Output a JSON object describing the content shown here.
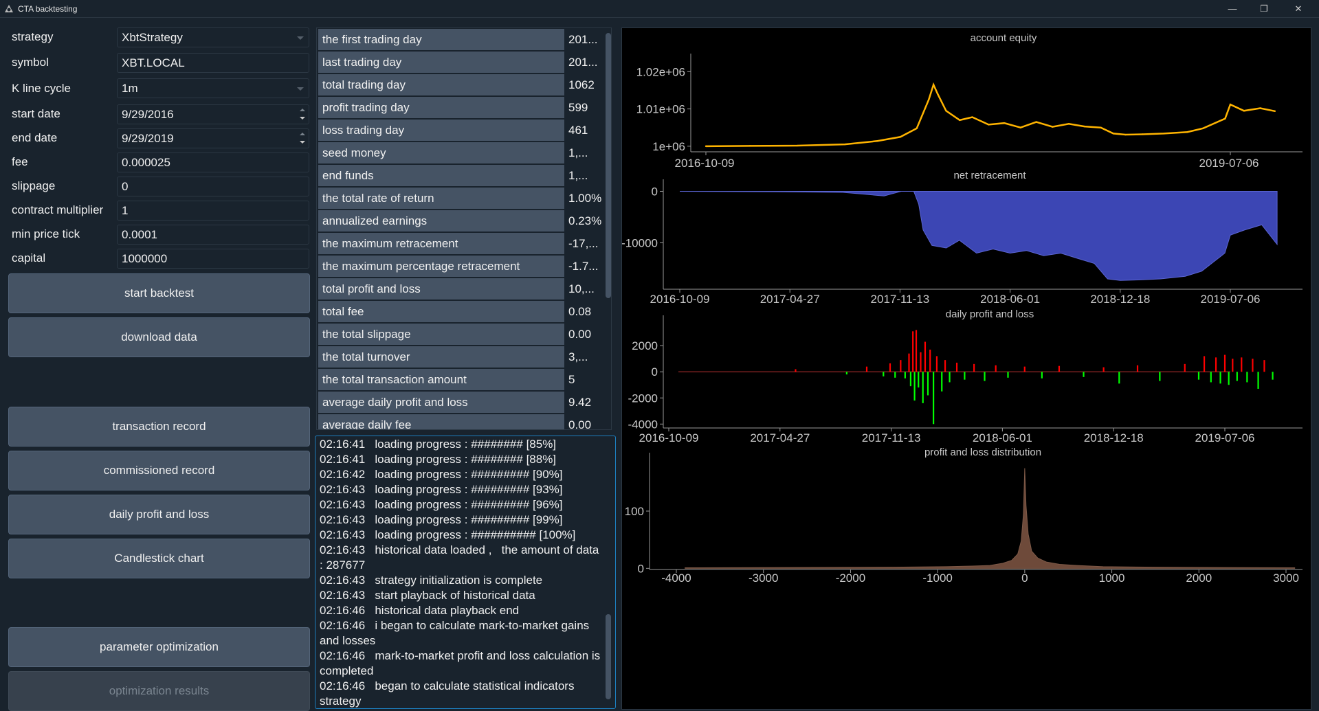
{
  "window": {
    "title": "CTA backtesting",
    "controls": [
      "—",
      "❐",
      "✕"
    ]
  },
  "form": {
    "strategy": {
      "label": "strategy",
      "value": "XbtStrategy"
    },
    "symbol": {
      "label": "symbol",
      "value": "XBT.LOCAL"
    },
    "kline": {
      "label": "K line cycle",
      "value": "1m"
    },
    "start_date": {
      "label": "start date",
      "value": "9/29/2016"
    },
    "end_date": {
      "label": "end date",
      "value": "9/29/2019"
    },
    "fee": {
      "label": "fee",
      "value": "0.000025"
    },
    "slippage": {
      "label": "slippage",
      "value": "0"
    },
    "contract_multiplier": {
      "label": "contract multiplier",
      "value": "1"
    },
    "min_price_tick": {
      "label": "min price tick",
      "value": "0.0001"
    },
    "capital": {
      "label": "capital",
      "value": "1000000"
    }
  },
  "buttons": {
    "start_backtest": "start backtest",
    "download_data": "download data",
    "transaction_record": "transaction record",
    "commissioned_record": "commissioned record",
    "daily_pnl": "daily profit and loss",
    "candlestick": "Candlestick chart",
    "param_opt": "parameter optimization",
    "opt_results": "optimization results"
  },
  "stats": [
    {
      "name": "the first trading day",
      "value": "201..."
    },
    {
      "name": "last trading day",
      "value": "201..."
    },
    {
      "name": "total trading day",
      "value": "1062"
    },
    {
      "name": "profit trading day",
      "value": "599"
    },
    {
      "name": "loss trading day",
      "value": "461"
    },
    {
      "name": "seed money",
      "value": "1,..."
    },
    {
      "name": "end funds",
      "value": "1,..."
    },
    {
      "name": "the total rate of return",
      "value": "1.00%"
    },
    {
      "name": "annualized earnings",
      "value": "0.23%"
    },
    {
      "name": "the maximum retracement",
      "value": "-17,..."
    },
    {
      "name": "the maximum percentage retracement",
      "value": "-1.7..."
    },
    {
      "name": "total profit and loss",
      "value": "10,..."
    },
    {
      "name": "total fee",
      "value": "0.08"
    },
    {
      "name": "the total slippage",
      "value": "0.00"
    },
    {
      "name": "the total turnover",
      "value": "3,..."
    },
    {
      "name": "the total transaction amount",
      "value": "5"
    },
    {
      "name": "average daily profit and loss",
      "value": "9.42"
    },
    {
      "name": "average daily fee",
      "value": "0.00"
    }
  ],
  "log": [
    "02:16:41   loading progress : ######## [85%]",
    "02:16:41   loading progress : ######## [88%]",
    "02:16:42   loading progress : ######### [90%]",
    "02:16:43   loading progress : ######### [93%]",
    "02:16:43   loading progress : ######### [96%]",
    "02:16:43   loading progress : ######### [99%]",
    "02:16:43   loading progress : ########## [100%]",
    "02:16:43   historical data loaded ,   the amount of data : 287677",
    "02:16:43   strategy initialization is complete",
    "02:16:43   start playback of historical data",
    "02:16:46   historical data playback end",
    "02:16:46   i began to calculate mark-to-market gains and losses",
    "02:16:46   mark-to-market profit and loss calculation is completed",
    "02:16:46   began to calculate statistical indicators",
    "strategy"
  ],
  "chart_data": [
    {
      "type": "line",
      "title": "account equity",
      "x_tick_labels": [
        "2016-10-09",
        "2019-07-06"
      ],
      "y_tick_labels": [
        "1e+06",
        "1.01e+06",
        "1.02e+06"
      ],
      "ylim": [
        998500,
        1023000
      ],
      "color": "#ffb400",
      "x": [
        "2016-10-09",
        "2017-01-01",
        "2017-04-01",
        "2017-07-01",
        "2017-09-01",
        "2017-10-15",
        "2017-11-15",
        "2017-12-08",
        "2017-12-17",
        "2017-12-25",
        "2018-01-10",
        "2018-02-05",
        "2018-03-01",
        "2018-04-01",
        "2018-05-01",
        "2018-06-01",
        "2018-07-01",
        "2018-08-01",
        "2018-09-01",
        "2018-10-01",
        "2018-11-01",
        "2018-11-25",
        "2018-12-18",
        "2019-01-20",
        "2019-03-01",
        "2019-04-15",
        "2019-05-15",
        "2019-06-26",
        "2019-07-06",
        "2019-08-01",
        "2019-09-01",
        "2019-09-29"
      ],
      "values": [
        1000000,
        1000100,
        1000150,
        1000500,
        1001400,
        1002500,
        1004800,
        1012500,
        1016500,
        1014000,
        1009500,
        1007000,
        1007800,
        1005800,
        1006200,
        1005000,
        1006500,
        1005200,
        1006000,
        1005300,
        1005000,
        1003400,
        1003100,
        1003200,
        1003400,
        1003800,
        1004800,
        1007400,
        1011200,
        1009500,
        1010200,
        1009400
      ]
    },
    {
      "type": "area",
      "title": "net retracement",
      "x_tick_labels": [
        "2016-10-09",
        "2017-04-27",
        "2017-11-13",
        "2018-06-01",
        "2018-12-18",
        "2019-07-06"
      ],
      "y_tick_labels": [
        "0",
        "-10000"
      ],
      "ylim": [
        -19000,
        1000
      ],
      "color": "#3c46b4",
      "x": [
        "2016-10-09",
        "2017-04-01",
        "2017-08-01",
        "2017-10-15",
        "2017-11-15",
        "2017-12-08",
        "2017-12-17",
        "2017-12-25",
        "2018-01-10",
        "2018-02-05",
        "2018-03-01",
        "2018-04-01",
        "2018-05-01",
        "2018-06-01",
        "2018-07-01",
        "2018-08-01",
        "2018-09-01",
        "2018-10-01",
        "2018-11-01",
        "2018-11-25",
        "2018-12-18",
        "2019-01-20",
        "2019-03-01",
        "2019-04-15",
        "2019-05-15",
        "2019-06-26",
        "2019-07-06",
        "2019-08-01",
        "2019-09-01",
        "2019-09-29"
      ],
      "values": [
        0,
        -80,
        -200,
        -900,
        0,
        0,
        -2500,
        -7500,
        -10500,
        -11000,
        -9500,
        -12000,
        -11200,
        -12000,
        -11500,
        -12500,
        -12000,
        -13000,
        -14000,
        -17000,
        -17300,
        -17200,
        -17000,
        -16500,
        -15500,
        -12000,
        -8500,
        -7500,
        -6500,
        -10300
      ]
    },
    {
      "type": "bar",
      "title": "daily profit and loss",
      "x_tick_labels": [
        "2016-10-09",
        "2017-04-27",
        "2017-11-13",
        "2018-06-01",
        "2018-12-18",
        "2019-07-06"
      ],
      "y_tick_labels": [
        "2000",
        "0",
        "-2000",
        "-4000"
      ],
      "ylim": [
        -4300,
        3800
      ],
      "colors": {
        "positive": "#ff0000",
        "negative": "#00ff00"
      },
      "x": [
        "2017-05-15",
        "2017-08-15",
        "2017-09-20",
        "2017-10-20",
        "2017-11-01",
        "2017-11-10",
        "2017-11-20",
        "2017-11-28",
        "2017-12-05",
        "2017-12-08",
        "2017-12-12",
        "2017-12-15",
        "2017-12-18",
        "2017-12-22",
        "2017-12-26",
        "2017-12-30",
        "2018-01-03",
        "2018-01-08",
        "2018-01-12",
        "2018-01-18",
        "2018-01-24",
        "2018-02-02",
        "2018-02-08",
        "2018-02-16",
        "2018-03-01",
        "2018-03-15",
        "2018-04-01",
        "2018-04-20",
        "2018-05-10",
        "2018-06-01",
        "2018-07-01",
        "2018-08-01",
        "2018-09-01",
        "2018-10-15",
        "2018-11-20",
        "2018-12-18",
        "2019-01-20",
        "2019-03-01",
        "2019-04-15",
        "2019-05-10",
        "2019-05-20",
        "2019-06-01",
        "2019-06-10",
        "2019-06-18",
        "2019-06-26",
        "2019-07-03",
        "2019-07-10",
        "2019-07-18",
        "2019-07-26",
        "2019-08-05",
        "2019-08-15",
        "2019-08-25",
        "2019-09-05",
        "2019-09-20"
      ],
      "values": [
        200,
        -200,
        400,
        -350,
        650,
        -450,
        900,
        -500,
        1400,
        -1100,
        3100,
        -2200,
        3200,
        -1200,
        1500,
        -2400,
        2300,
        -1800,
        1700,
        -4000,
        1200,
        -1500,
        900,
        -800,
        700,
        -600,
        600,
        -700,
        500,
        -450,
        400,
        -500,
        450,
        -400,
        350,
        -900,
        500,
        -700,
        600,
        -600,
        1200,
        -800,
        1100,
        -900,
        1300,
        -1000,
        1000,
        -700,
        1100,
        -800,
        1000,
        -1300,
        900,
        -600
      ]
    },
    {
      "type": "area",
      "title": "profit and loss distribution",
      "x_tick_labels": [
        "-4000",
        "-3000",
        "-2000",
        "-1000",
        "0",
        "1000",
        "2000",
        "3000"
      ],
      "y_tick_labels": [
        "100",
        "0"
      ],
      "xlim": [
        -4150,
        3150
      ],
      "ylim": [
        -2,
        190
      ],
      "color": "#6e4a3a",
      "x": [
        -3900,
        -1500,
        -900,
        -600,
        -400,
        -250,
        -150,
        -80,
        -40,
        -15,
        0,
        15,
        40,
        80,
        150,
        250,
        400,
        600,
        900,
        1500,
        3100
      ],
      "values": [
        1,
        2,
        3,
        4,
        5,
        9,
        14,
        25,
        48,
        95,
        175,
        110,
        60,
        30,
        18,
        11,
        7,
        5,
        3,
        2,
        1
      ]
    }
  ]
}
